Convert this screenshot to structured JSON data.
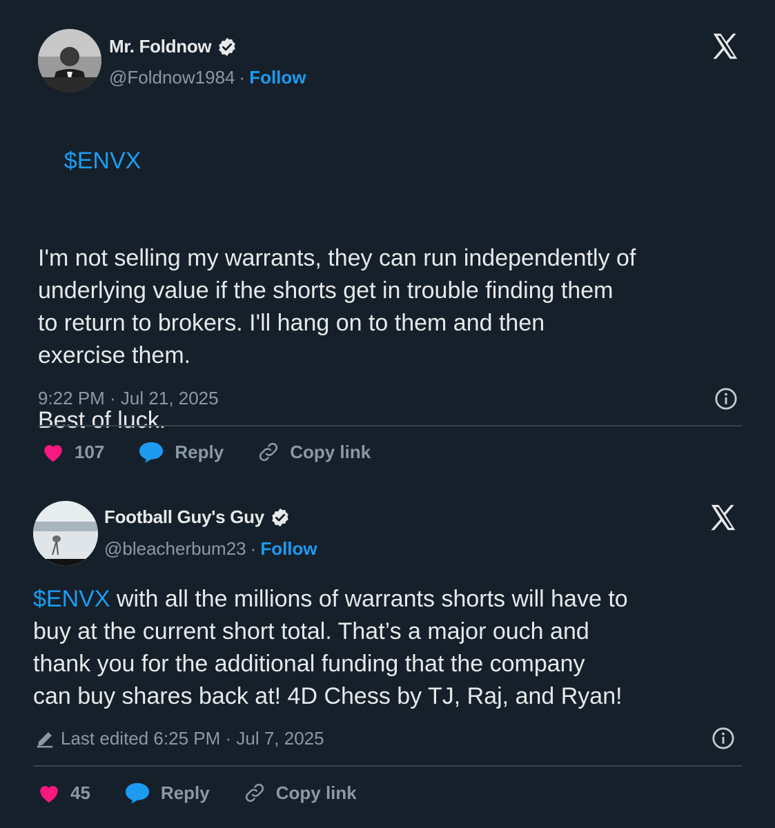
{
  "tweets": [
    {
      "display_name": "Mr. Foldnow",
      "handle": "@Foldnow1984",
      "separator": "·",
      "follow_label": "Follow",
      "cashtag": "$ENVX",
      "body_rest": "I'm not selling my warrants, they can run independently of\nunderlying value if the shorts get in trouble finding them\nto return to brokers. I'll hang on to them and then\nexercise them.\n\nBest of luck.",
      "timestamp": "9:22 PM · Jul 21, 2025",
      "likes": "107",
      "reply_label": "Reply",
      "copy_label": "Copy link"
    },
    {
      "display_name": "Football Guy's Guy",
      "handle": "@bleacherbum23",
      "separator": "·",
      "follow_label": "Follow",
      "cashtag": "$ENVX",
      "body_rest": " with all the millions of warrants shorts will have to\nbuy at the current short total. That’s a major ouch and\nthank you for the additional funding that the company\ncan buy shares back at! 4D Chess by TJ, Raj, and Ryan!",
      "timestamp": "Last edited 6:25 PM · Jul 7, 2025",
      "likes": "45",
      "reply_label": "Reply",
      "copy_label": "Copy link"
    }
  ],
  "colors": {
    "background": "#15202b",
    "accent": "#1d9bf0",
    "like": "#f91880",
    "muted": "#8b98a5"
  },
  "icons": [
    "verified-badge-icon",
    "x-logo-icon",
    "info-icon",
    "heart-icon",
    "reply-bubble-icon",
    "link-icon",
    "pencil-icon"
  ]
}
